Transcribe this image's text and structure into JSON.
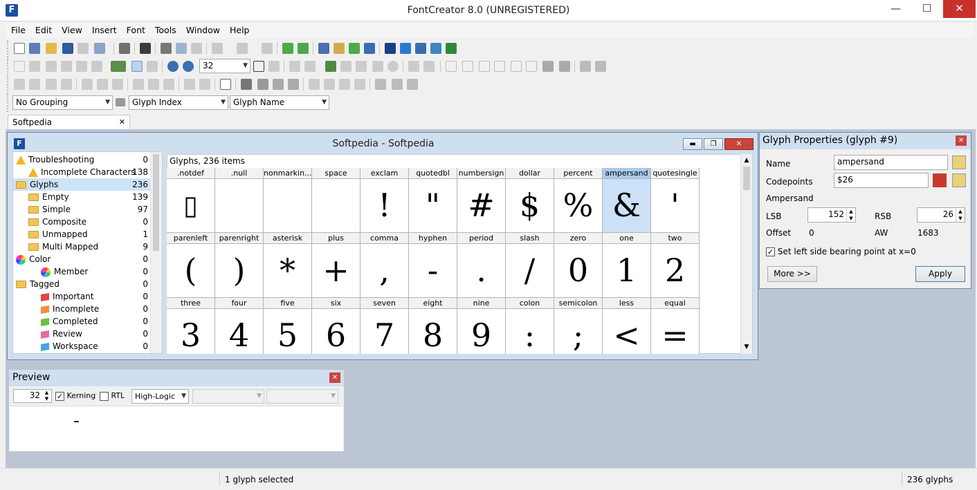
{
  "app": {
    "title": "FontCreator 8.0 (UNREGISTERED)",
    "icon": "fontcreator-logo-icon"
  },
  "window_controls": {
    "minimize": "—",
    "maximize": "☐",
    "close": "✕"
  },
  "menu": [
    "File",
    "Edit",
    "View",
    "Insert",
    "Font",
    "Tools",
    "Window",
    "Help"
  ],
  "toolbar": {
    "zoom_value": "32"
  },
  "filters": {
    "grouping": "No Grouping",
    "index": "Glyph Index",
    "name": "Glyph Name"
  },
  "doc_tab": {
    "label": "Softpedia",
    "close": "✕"
  },
  "inner_window": {
    "title": "Softpedia - Softpedia"
  },
  "tree": [
    {
      "label": "Troubleshooting",
      "count": "0",
      "icon": "warning-icon",
      "indent": 0
    },
    {
      "label": "Incomplete Characters",
      "count": "138",
      "icon": "warning-icon",
      "indent": 1
    },
    {
      "label": "Glyphs",
      "count": "236",
      "icon": "folder-icon",
      "indent": 0,
      "selected": true
    },
    {
      "label": "Empty",
      "count": "139",
      "icon": "folder-icon",
      "indent": 1
    },
    {
      "label": "Simple",
      "count": "97",
      "icon": "folder-icon",
      "indent": 1
    },
    {
      "label": "Composite",
      "count": "0",
      "icon": "folder-icon",
      "indent": 1
    },
    {
      "label": "Unmapped",
      "count": "1",
      "icon": "folder-icon",
      "indent": 1
    },
    {
      "label": "Multi Mapped",
      "count": "9",
      "icon": "folder-icon",
      "indent": 1
    },
    {
      "label": "Color",
      "count": "0",
      "icon": "color-wheel-icon",
      "indent": 0
    },
    {
      "label": "Member",
      "count": "0",
      "icon": "color-wheel-icon",
      "indent": 2
    },
    {
      "label": "Tagged",
      "count": "0",
      "icon": "folder-icon",
      "indent": 0
    },
    {
      "label": "Important",
      "count": "0",
      "icon": "flag-red-icon",
      "indent": 2
    },
    {
      "label": "Incomplete",
      "count": "0",
      "icon": "flag-orange-icon",
      "indent": 2
    },
    {
      "label": "Completed",
      "count": "0",
      "icon": "flag-green-icon",
      "indent": 2
    },
    {
      "label": "Review",
      "count": "0",
      "icon": "flag-pink-icon",
      "indent": 2
    },
    {
      "label": "Workspace",
      "count": "0",
      "icon": "flag-blue-icon",
      "indent": 2
    }
  ],
  "grid": {
    "header": "Glyphs, 236 items",
    "rows": [
      [
        {
          "name": ".notdef",
          "glyph": "▯"
        },
        {
          "name": ".null",
          "glyph": ""
        },
        {
          "name": "nonmarkin...",
          "glyph": ""
        },
        {
          "name": "space",
          "glyph": ""
        },
        {
          "name": "exclam",
          "glyph": "!"
        },
        {
          "name": "quotedbl",
          "glyph": "\""
        },
        {
          "name": "numbersign",
          "glyph": "#"
        },
        {
          "name": "dollar",
          "glyph": "$"
        },
        {
          "name": "percent",
          "glyph": "%"
        },
        {
          "name": "ampersand",
          "glyph": "&",
          "selected": true
        },
        {
          "name": "quotesingle",
          "glyph": "'"
        }
      ],
      [
        {
          "name": "parenleft",
          "glyph": "("
        },
        {
          "name": "parenright",
          "glyph": ")"
        },
        {
          "name": "asterisk",
          "glyph": "*"
        },
        {
          "name": "plus",
          "glyph": "+"
        },
        {
          "name": "comma",
          "glyph": ","
        },
        {
          "name": "hyphen",
          "glyph": "-"
        },
        {
          "name": "period",
          "glyph": "."
        },
        {
          "name": "slash",
          "glyph": "/"
        },
        {
          "name": "zero",
          "glyph": "0"
        },
        {
          "name": "one",
          "glyph": "1"
        },
        {
          "name": "two",
          "glyph": "2"
        }
      ],
      [
        {
          "name": "three",
          "glyph": "3"
        },
        {
          "name": "four",
          "glyph": "4"
        },
        {
          "name": "five",
          "glyph": "5"
        },
        {
          "name": "six",
          "glyph": "6"
        },
        {
          "name": "seven",
          "glyph": "7"
        },
        {
          "name": "eight",
          "glyph": "8"
        },
        {
          "name": "nine",
          "glyph": "9"
        },
        {
          "name": "colon",
          "glyph": ":"
        },
        {
          "name": "semicolon",
          "glyph": ";"
        },
        {
          "name": "less",
          "glyph": "<"
        },
        {
          "name": "equal",
          "glyph": "="
        }
      ]
    ]
  },
  "properties": {
    "title": "Glyph Properties (glyph #9)",
    "name_label": "Name",
    "name_value": "ampersand",
    "codepoints_label": "Codepoints",
    "codepoints_value": "$26",
    "char_name": "Ampersand",
    "lsb_label": "LSB",
    "lsb_value": "152",
    "rsb_label": "RSB",
    "rsb_value": "26",
    "offset_label": "Offset",
    "offset_value": "0",
    "aw_label": "AW",
    "aw_value": "1683",
    "checkbox_label": "Set left side bearing point at x=0",
    "more_button": "More >>",
    "apply_button": "Apply"
  },
  "preview": {
    "title": "Preview",
    "size": "32",
    "kerning_label": "Kerning",
    "rtl_label": "RTL",
    "layout": "High-Logic",
    "sample": "-"
  },
  "status": {
    "selected": "1 glyph selected",
    "count": "236 glyphs"
  },
  "colors": {
    "accent": "#1a4fa0",
    "mdi_title": "#cfdfef",
    "selection": "#cce0f8",
    "close_red": "#c7312c"
  }
}
